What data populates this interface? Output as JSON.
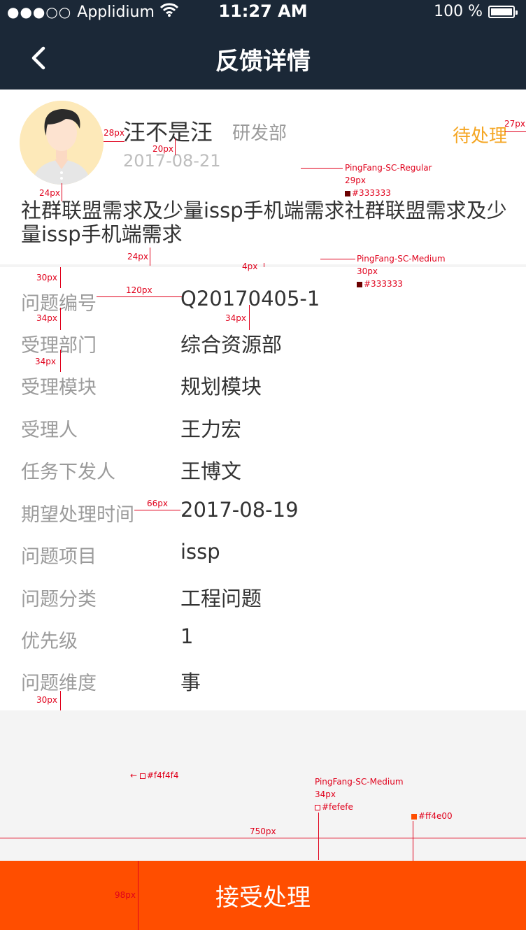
{
  "status_bar": {
    "signal": "●●●○○",
    "carrier": "Applidium",
    "time": "11:27 AM",
    "battery": "100 %"
  },
  "nav": {
    "title": "反馈详情",
    "back_icon": "chevron-left-icon"
  },
  "feedback": {
    "user_name": "汪不是汪",
    "department": "研发部",
    "date": "2017-08-21",
    "status": "待处理",
    "content": "社群联盟需求及少量issp手机端需求社群联盟需求及少量issp手机端需求"
  },
  "details": [
    {
      "label": "问题编号",
      "value": "Q20170405-1"
    },
    {
      "label": "受理部门",
      "value": "综合资源部"
    },
    {
      "label": "受理模块",
      "value": "规划模块"
    },
    {
      "label": "受理人",
      "value": "王力宏"
    },
    {
      "label": "任务下发人",
      "value": "王博文"
    },
    {
      "label": "期望处理时间",
      "value": "2017-08-19"
    },
    {
      "label": "问题项目",
      "value": "issp"
    },
    {
      "label": "问题分类",
      "value": "工程问题"
    },
    {
      "label": "优先级",
      "value": "1"
    },
    {
      "label": "问题维度",
      "value": "事"
    }
  ],
  "action": {
    "accept_label": "接受处理"
  },
  "colors": {
    "nav_bg": "#1b2837",
    "accent": "#ff4e00",
    "status": "#f5a623",
    "text": "#333333",
    "background": "#f4f4f4",
    "button_text": "#fefefe"
  },
  "annotations": {
    "a28": "28px",
    "a20": "20px",
    "a27": "27px",
    "a24a": "24px",
    "a24b": "24px",
    "a4": "4px",
    "a30a": "30px",
    "a120": "120px",
    "a34a": "34px",
    "a34b": "34px",
    "a34c": "34px",
    "a66": "66px",
    "a30b": "30px",
    "a750": "750px",
    "a98": "98px",
    "spec1_font": "PingFang-SC-Regular",
    "spec1_size": "29px",
    "spec1_color": "#333333",
    "spec2_font": "PingFang-SC-Medium",
    "spec2_size": "30px",
    "spec2_color": "#333333",
    "spec3_font": "PingFang-SC-Medium",
    "spec3_size": "34px",
    "spec3_color": "#fefefe",
    "bg_color": "#f4f4f4",
    "btn_color": "#ff4e00"
  }
}
